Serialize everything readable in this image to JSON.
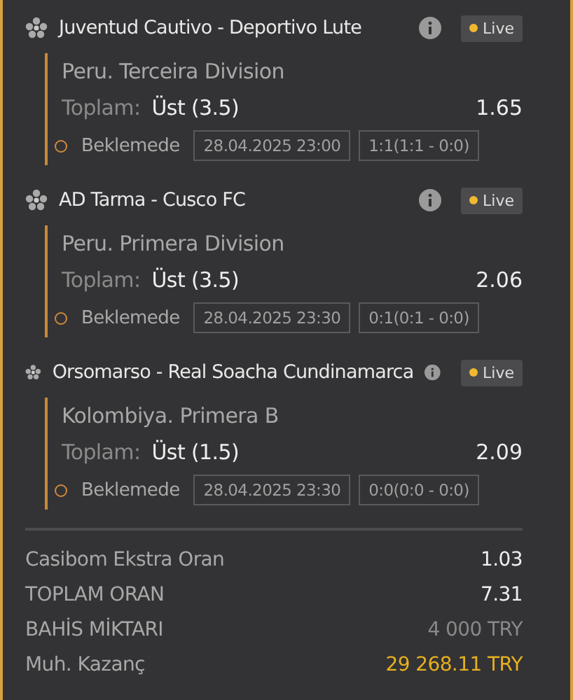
{
  "bets": [
    {
      "match": "Juventud Cautivo - Deportivo Lute",
      "live": "Live",
      "league": "Peru. Terceira Division",
      "market": "Toplam:",
      "pick": "Üst (3.5)",
      "odds": "1.65",
      "status": "Beklemede",
      "date": "28.04.2025 23:00",
      "score": "1:1(1:1 - 0:0)"
    },
    {
      "match": "AD Tarma - Cusco FC",
      "live": "Live",
      "league": "Peru. Primera Division",
      "market": "Toplam:",
      "pick": "Üst (3.5)",
      "odds": "2.06",
      "status": "Beklemede",
      "date": "28.04.2025 23:30",
      "score": "0:1(0:1 - 0:0)"
    },
    {
      "match": "Orsomarso - Real Soacha Cundinamarca",
      "live": "Live",
      "league": "Kolombiya. Primera B",
      "market": "Toplam:",
      "pick": "Üst (1.5)",
      "odds": "2.09",
      "status": "Beklemede",
      "date": "28.04.2025 23:30",
      "score": "0:0(0:0 - 0:0)"
    }
  ],
  "summary": [
    {
      "label": "Casibom Ekstra Oran",
      "value": "1.03",
      "kind": "strong"
    },
    {
      "label": "TOPLAM ORAN",
      "value": "7.31",
      "kind": "strong"
    },
    {
      "label": "BAHİS MİKTARI",
      "value": "4 000 TRY",
      "kind": "muted"
    },
    {
      "label": "Muh. Kazanç",
      "value": "29 268.11 TRY",
      "kind": "accent"
    }
  ]
}
